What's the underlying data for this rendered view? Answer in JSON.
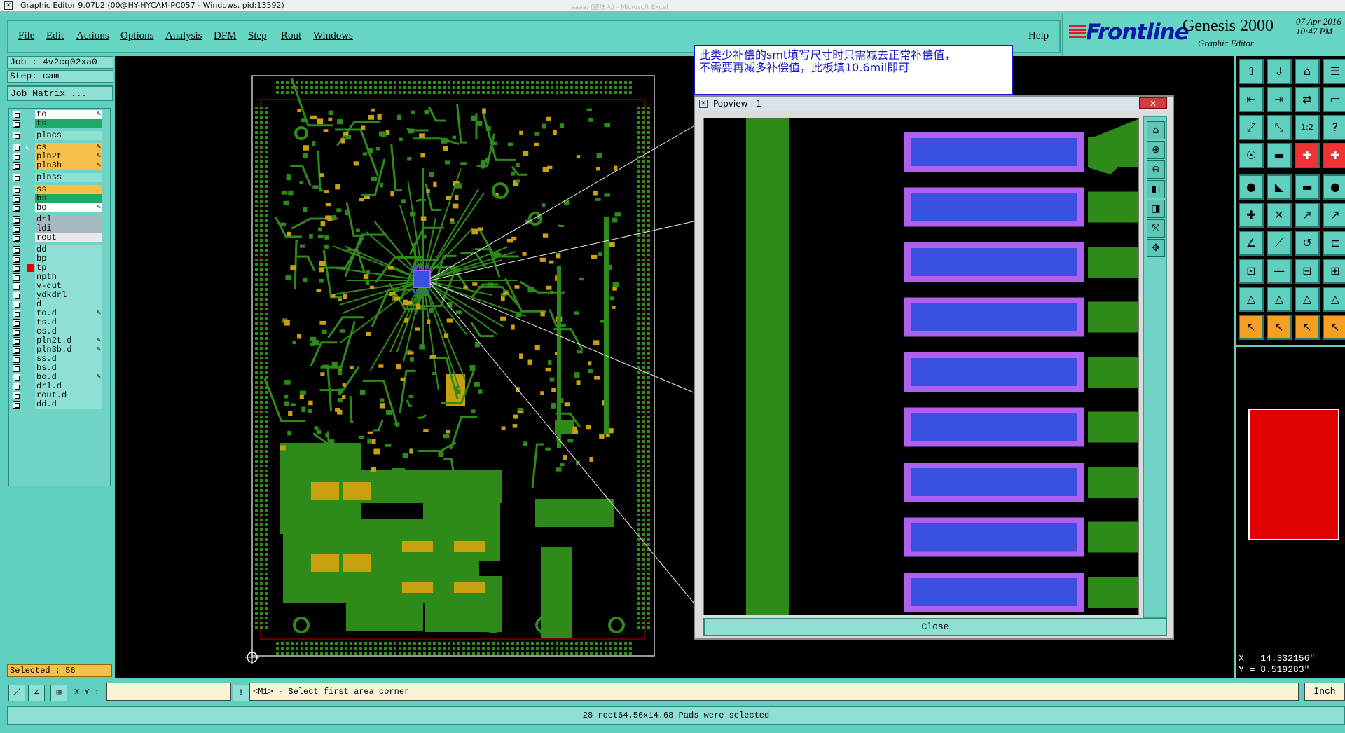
{
  "window": {
    "title": "Graphic Editor 9.07b2 (00@HY-HYCAM-PC057 - Windows, pid:13592)",
    "background_hint": "aaaa:  (整理入) - Microsoft Excel"
  },
  "menu": {
    "items": [
      "File",
      "Edit",
      "Actions",
      "Options",
      "Analysis",
      "DFM",
      "Step",
      "Rout",
      "Windows"
    ],
    "help": "Help"
  },
  "logo": {
    "brand": "Frontline",
    "product": "Genesis 2000",
    "subtitle": "Graphic Editor",
    "date": "07 Apr 2016",
    "time": "10:47 PM"
  },
  "job": {
    "job_label": "Job : 4v2cq02xa0",
    "step_label": "Step: cam",
    "matrix_button": "Job Matrix ..."
  },
  "layers": [
    {
      "name": "to",
      "color": "#ffffff",
      "flag": "✎"
    },
    {
      "name": "ts",
      "color": "#1ea86a",
      "flag": ""
    },
    {
      "name": "plncs",
      "color": "#8fe0d4",
      "flag": ""
    },
    {
      "name": "cs",
      "color": "#f5c04a",
      "flag": "✎",
      "active": true
    },
    {
      "name": "pln2t",
      "color": "#f5c04a",
      "flag": "✎"
    },
    {
      "name": "pln3b",
      "color": "#f5c04a",
      "flag": "✎"
    },
    {
      "name": "plnss",
      "color": "#8fe0d4",
      "flag": ""
    },
    {
      "name": "ss",
      "color": "#f5c04a",
      "flag": ""
    },
    {
      "name": "bs",
      "color": "#1ea86a",
      "flag": ""
    },
    {
      "name": "bo",
      "color": "#ffffff",
      "flag": "✎"
    },
    {
      "name": "drl",
      "color": "#a8b8c0",
      "flag": ""
    },
    {
      "name": "ldi",
      "color": "#a8b8c0",
      "flag": ""
    },
    {
      "name": "rout",
      "color": "#e8e8e8",
      "flag": ""
    },
    {
      "name": "dd",
      "color": "#8fe0d4",
      "flag": ""
    },
    {
      "name": "bp",
      "color": "#8fe0d4",
      "flag": ""
    },
    {
      "name": "tp",
      "color": "#8fe0d4",
      "flag": "",
      "red": true
    },
    {
      "name": "npth",
      "color": "#8fe0d4",
      "flag": ""
    },
    {
      "name": "v-cut",
      "color": "#8fe0d4",
      "flag": ""
    },
    {
      "name": "ydkdrl",
      "color": "#8fe0d4",
      "flag": ""
    },
    {
      "name": "d",
      "color": "#8fe0d4",
      "flag": ""
    },
    {
      "name": "to.d",
      "color": "#8fe0d4",
      "flag": "✎"
    },
    {
      "name": "ts.d",
      "color": "#8fe0d4",
      "flag": ""
    },
    {
      "name": "cs.d",
      "color": "#8fe0d4",
      "flag": ""
    },
    {
      "name": "pln2t.d",
      "color": "#8fe0d4",
      "flag": "✎"
    },
    {
      "name": "pln3b.d",
      "color": "#8fe0d4",
      "flag": "✎"
    },
    {
      "name": "ss.d",
      "color": "#8fe0d4",
      "flag": ""
    },
    {
      "name": "bs.d",
      "color": "#8fe0d4",
      "flag": ""
    },
    {
      "name": "bo.d",
      "color": "#8fe0d4",
      "flag": "✎"
    },
    {
      "name": "drl.d",
      "color": "#8fe0d4",
      "flag": ""
    },
    {
      "name": "rout.d",
      "color": "#8fe0d4",
      "flag": ""
    },
    {
      "name": "dd.d",
      "color": "#8fe0d4",
      "flag": ""
    }
  ],
  "selected": "Selected : 56",
  "annotation": {
    "line1": "此类少补偿的smt填写尺寸时只需减去正常补偿值，",
    "line2": "不需要再减多补偿值，此板填10.6mil即可"
  },
  "popview": {
    "title": "Popview - 1",
    "close_button": "Close"
  },
  "coords": {
    "x": "X = 14.332156\"",
    "y": "Y = 8.519283\""
  },
  "cmd": {
    "xy_label": "X Y :",
    "xy_value": "",
    "prompt": "<M1> - Select first area corner",
    "units": "Inch"
  },
  "status": "28 rect64.56x14.68 Pads were selected",
  "colors": {
    "panel": "#5fcfc0",
    "copper": "#2e8b1a",
    "pad": "#c8a010",
    "selected_pad": "#3a50e0",
    "pad_outline": "#b060f0",
    "accent_red": "#e00000"
  }
}
